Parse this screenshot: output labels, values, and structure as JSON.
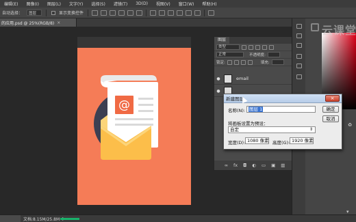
{
  "menu": {
    "items": [
      "编辑(E)",
      "图像(I)",
      "图层(L)",
      "文字(Y)",
      "选择(S)",
      "滤镜(T)",
      "3D(D)",
      "视图(V)",
      "窗口(W)",
      "帮助(H)"
    ]
  },
  "options_bar": {
    "label_auto_select": "自动选择：",
    "group_select": "图层",
    "show_transform": "显示变换控件"
  },
  "document": {
    "tab_title": "的应用.psd @ 25%(RGB/8)",
    "tab_close": "×"
  },
  "status_bar": {
    "doc_info": "文档:8.15M/25.8M",
    "arrow": "▶",
    "progress": 1.0
  },
  "layers_panel": {
    "title": "图层",
    "filter_label": "类型",
    "blend_mode": "正常",
    "opacity_label": "不透明度:",
    "lock_label": "锁定:",
    "fill_label": "填充:",
    "layers": [
      {
        "name": "email",
        "visible": true
      }
    ],
    "footer_icons": [
      "link-icon",
      "fx-icon",
      "mask-icon",
      "adjustment-icon",
      "folder-icon",
      "new-layer-icon",
      "trash-icon"
    ]
  },
  "dialog": {
    "title": "新建图层",
    "close": "×",
    "name_label": "名称(N):",
    "name_value": "图层 1",
    "preset_label": "将画板设置为预设：",
    "preset_value": "自定",
    "width_label": "宽度(D):",
    "width_value": "1080 像素",
    "height_label": "高度(G):",
    "height_value": "1920 像素",
    "ok_label": "确定",
    "cancel_label": "取消"
  },
  "watermark": {
    "text": "云课堂"
  },
  "artwork": {
    "background_color": "#f57c57",
    "circle_color": "#3c3f52",
    "envelope_color": "#fcbe4a",
    "envelope_flap_color": "#fcd57a",
    "paper_color": "#ffffff",
    "at_badge_color": "#f06a44",
    "at_symbol": "@"
  }
}
